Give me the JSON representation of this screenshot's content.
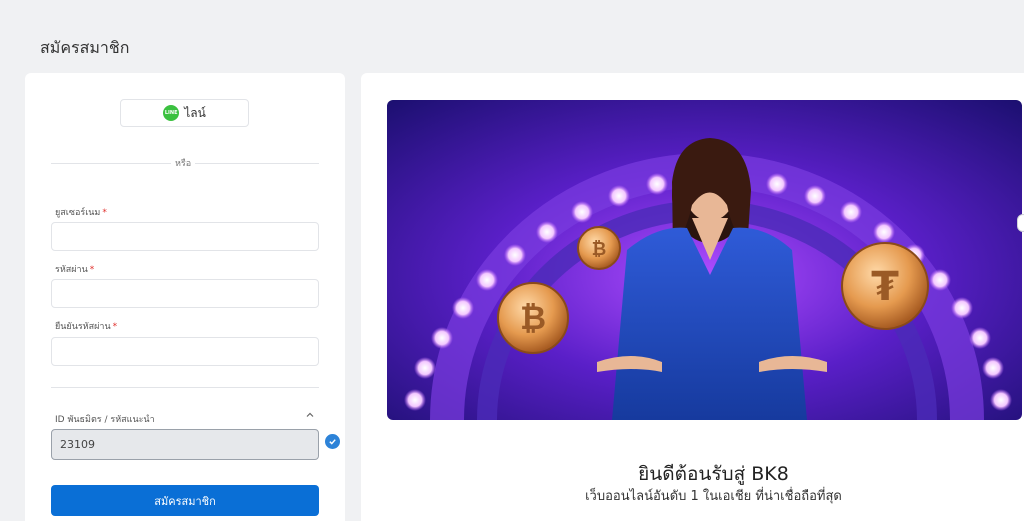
{
  "page": {
    "title": "สมัครสมาชิก"
  },
  "form": {
    "line_login_label": "ไลน์",
    "line_icon_text": "LINE",
    "or_label": "หรือ",
    "username_label": "ยูสเซอร์เนม",
    "username_value": "",
    "password_label": "รหัสผ่าน",
    "password_value": "",
    "confirm_password_label": "ยืนยันรหัสผ่าน",
    "confirm_password_value": "",
    "required_marker": "*",
    "referral_label": "ID พันธมิตร / รหัสแนะนำ",
    "referral_value": "23109",
    "submit_label": "สมัครสมาชิก"
  },
  "promo": {
    "welcome_title": "ยินดีต้อนรับสู่ BK8",
    "welcome_subtitle": "เว็บออนไลน์อันดับ 1 ในเอเชีย ที่น่าเชื่อถือที่สุด"
  },
  "colors": {
    "primary": "#0a6fd6",
    "line_green": "#3bc140",
    "required": "#e0302c",
    "verified": "#2d83d8"
  }
}
